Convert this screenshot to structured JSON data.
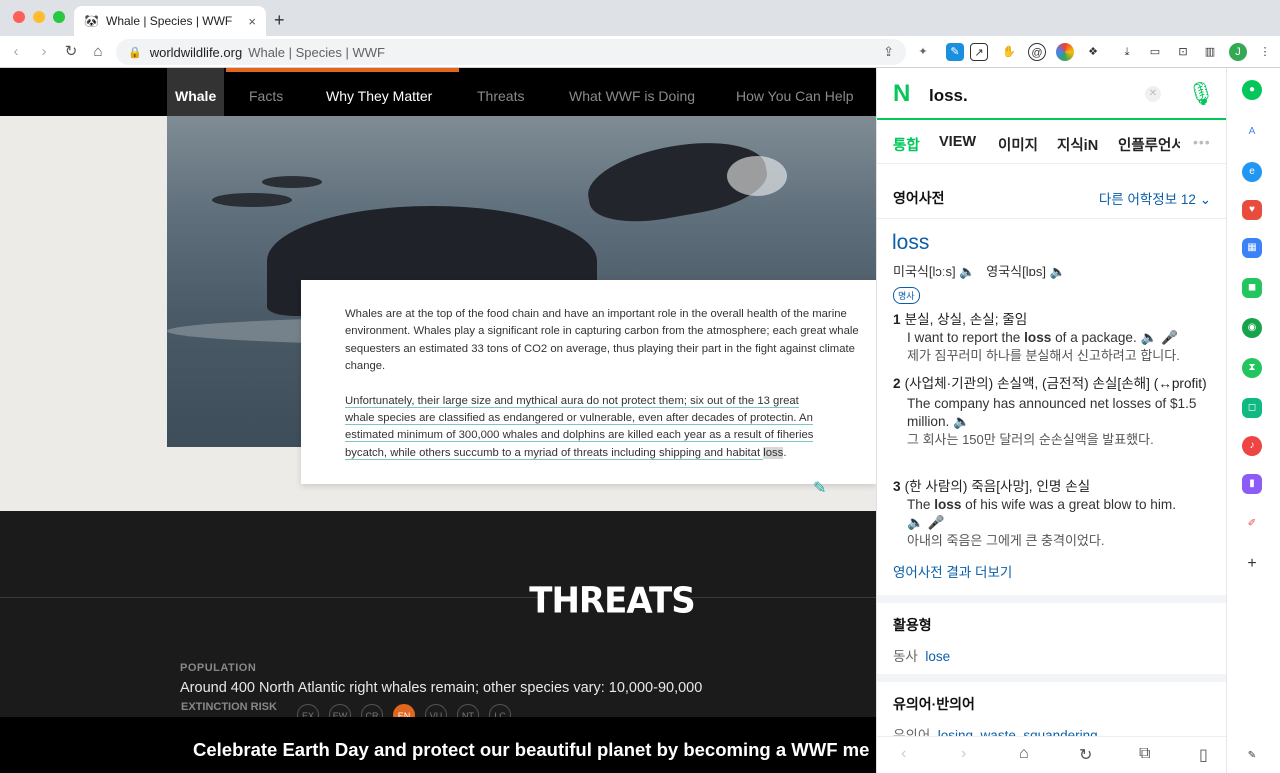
{
  "browser": {
    "tab_title": "Whale | Species | WWF",
    "tab_icon": "panda-icon",
    "url_domain": "worldwildlife.org",
    "url_title": "Whale | Species | WWF"
  },
  "wwf_nav": {
    "items": [
      "Whale",
      "Facts",
      "Why They Matter",
      "Threats",
      "What WWF is Doing",
      "How You Can Help"
    ]
  },
  "article": {
    "p1": "Whales are at the top of the food chain and have an important role in the overall health of the marine environment. Whales play a significant role in capturing carbon from the atmosphere; each great whale sequesters an estimated 33 tons of CO2 on average, thus playing their part in the fight against climate change.",
    "p2_l1": "Unfortunately, their large size and mythical aura do not protect them; six out of the 13 great",
    "p2_l2": "whale species are classified as endangered or vulnerable, even after decades of protecti",
    "p2_l2b": "n. An",
    "p2_l3": "estimated minimum of 300,000 whales and dolphins are killed each year as a result of fi",
    "p2_l3b": "heries",
    "p2_l4": "bycatch, while others succumb to a myriad of threats including shipping and habitat ",
    "p2_loss": "loss",
    "p2_end": "."
  },
  "threats": {
    "title": "THREATS",
    "population_label": "POPULATION",
    "population_value": "Around 400 North Atlantic right whales remain; other species vary: 10,000-90,000",
    "extinction_label": "EXTINCTION RISK",
    "risk_levels": [
      "EX",
      "EW",
      "CR",
      "EN",
      "VU",
      "NT",
      "LC"
    ],
    "active_risk": "EN"
  },
  "banner": {
    "text": "Celebrate Earth Day and protect our beautiful planet by becoming a WWF me"
  },
  "naver": {
    "query": "loss.",
    "tabs": [
      "통합",
      "VIEW",
      "이미지",
      "지식iN",
      "인플루언서"
    ],
    "dict_title": "영어사전",
    "more_info": "다른 어학정보 12",
    "word": "loss",
    "pron_us": "미국식[lɔːs]",
    "pron_uk": "영국식[lɒs]",
    "pos": "명사",
    "defs": [
      {
        "num": "1",
        "meaning": "분실, 상실, 손실; 줄임",
        "example_pre": "I want to report the ",
        "example_bold": "loss",
        "example_post": " of a package.",
        "kr": "제가 짐꾸러미 하나를 분실해서 신고하려고 합니다."
      },
      {
        "num": "2",
        "meaning": "(사업체·기관의) 손실액, (금전적) 손실[손해] (↔profit)",
        "example_pre": "The company has announced net losses of $1.5 million.",
        "example_bold": "",
        "example_post": "",
        "kr": "그 회사는 150만 달러의 순손실액을 발표했다."
      },
      {
        "num": "3",
        "meaning": "(한 사람의) 죽음[사망], 인명 손실",
        "example_pre": "The ",
        "example_bold": "loss",
        "example_post": " of his wife was a great blow to him.",
        "kr": "아내의 죽음은 그에게 큰 충격이었다."
      }
    ],
    "dict_more": "영어사전 결과 더보기",
    "usage_title": "활용형",
    "usage_label": "동사",
    "usage_value": "lose",
    "syn_title": "유의어·반의어",
    "syn_label": "유의어",
    "syn_values": "losing, waste, squandering"
  },
  "colors": {
    "accent_orange": "#e2661d",
    "naver_green": "#03c75a",
    "link_blue": "#0a5fa8"
  }
}
